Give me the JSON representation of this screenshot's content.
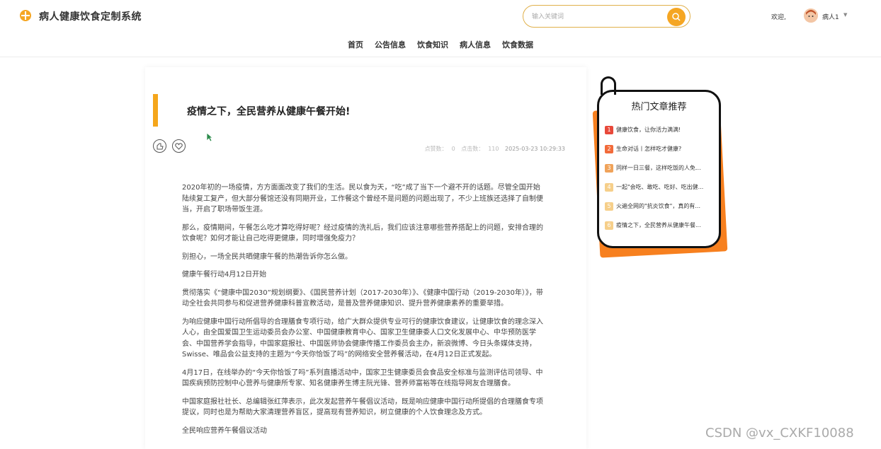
{
  "header": {
    "title": "病人健康饮食定制系统",
    "search_placeholder": "输入关键词",
    "welcome": "欢迎,",
    "username": "病人1"
  },
  "nav": {
    "items": [
      "首页",
      "公告信息",
      "饮食知识",
      "病人信息",
      "饮食数据"
    ]
  },
  "article": {
    "title": "疫情之下，全民营养从健康午餐开始!",
    "likes_label": "点赞数：",
    "likes": "0",
    "clicks_label": "点击数：",
    "clicks": "110",
    "date": "2025-03-23 10:29:33",
    "paragraphs": [
      "2020年初的一场疫情，方方面面改变了我们的生活。民以食为天，“吃”成了当下一个避不开的话题。尽管全国开始陆续复工复产，但大部分餐馆还没有同期开业，工作餐这个曾经不是问题的问题出现了，不少上班族还选择了自制便当，开启了职场带饭生涯。",
      "那么，疫情期间，午餐怎么吃才算吃得好呢？经过疫情的洗礼后，我们应该注意哪些营养搭配上的问题，安排合理的饮食呢？如何才能让自己吃得更健康，同时增强免疫力？",
      "别担心，一场全民共晒健康午餐的热潮告诉你怎么做。",
      "健康午餐行动4月12日开始",
      "贯彻落实《“健康中国2030”规划纲要》、《国民营养计划（2017-2030年）》、《健康中国行动（2019-2030年）》，带动全社会共同参与和促进营养健康科普宣教活动，是普及营养健康知识、提升营养健康素养的重要举措。",
      "为响应健康中国行动所倡导的合理膳食专项行动，给广大群众提供专业可行的健康饮食建议，让健康饮食的理念深入人心，由全国爱国卫生运动委员会办公室、中国健康教育中心、国家卫生健康委人口文化发展中心、中华预防医学会、中国营养学会指导，中国家庭报社、中国医师协会健康传播工作委员会主办，新浪微博、今日头条媒体支持，Swisse、唯品会公益支持的主题为“今天你恰饭了吗”的网络安全营养餐活动，在4月12日正式发起。",
      "4月17日，在线举办的“今天你恰饭了吗”系列直播活动中，国家卫生健康委员会食品安全标准与监测评估司领导、中国疾病预防控制中心营养与健康所专家、知名健康养生博主阮光锋、营养师富裕等在线指导网友合理膳食。",
      "中国家庭报社社长、总编辑张红萍表示，此次发起营养午餐倡议活动，既是响应健康中国行动所提倡的合理膳食专项提议，同时也是为帮助大家清理营养盲区，提高现有营养知识，树立健康的个人饮食理念及方式。",
      "全民响应营养午餐倡议活动"
    ]
  },
  "sidebar": {
    "title": "热门文章推荐",
    "items": [
      {
        "rank": "1",
        "text": "健康饮食，让你活力满满!",
        "color": "#e8493a"
      },
      {
        "rank": "2",
        "text": "生命对话丨怎样吃才健康?",
        "color": "#f26b3a"
      },
      {
        "rank": "3",
        "text": "同样一日三餐，这样吃饭的人免...",
        "color": "#f0a35a"
      },
      {
        "rank": "4",
        "text": "一起\"会吃、敢吃、吃好、吃出健...",
        "color": "#f6cf8a"
      },
      {
        "rank": "5",
        "text": "火遍全网的\"抗炎饮食\"，真的有...",
        "color": "#f6cf8a"
      },
      {
        "rank": "6",
        "text": "疫情之下，全民营养从健康午餐...",
        "color": "#f6cf8a"
      }
    ]
  },
  "watermark": "CSDN @vx_CXKF10088",
  "colors": {
    "accent": "#f5a623",
    "title_bar": "#f5a61b",
    "card_back": "#f7801f"
  }
}
